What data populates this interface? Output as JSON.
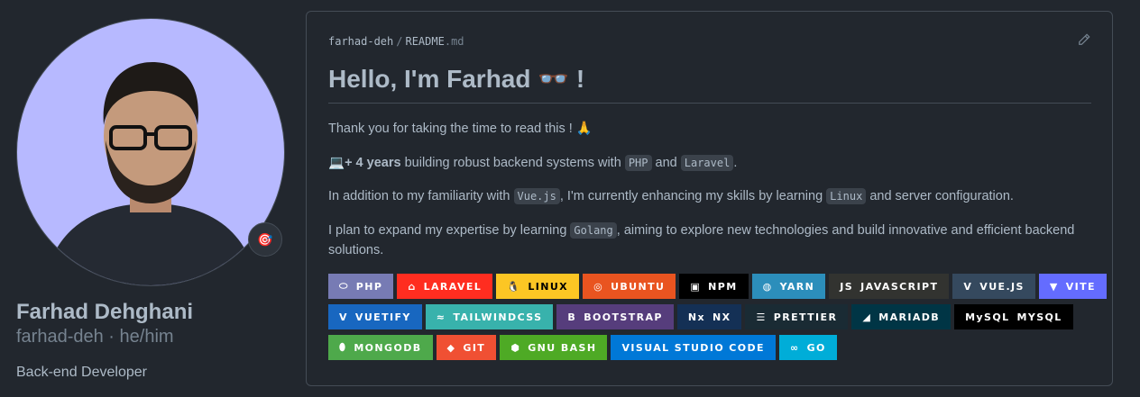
{
  "profile": {
    "name": "Farhad Dehghani",
    "handle": "farhad-deh · he/him",
    "bio": "Back-end Developer",
    "status_emoji": "🎯",
    "avatar_bg": "#b7b9ff"
  },
  "readme": {
    "user": "farhad-deh",
    "separator": "/",
    "file": "README",
    "ext": ".md",
    "title": "Hello, I'm Farhad 👓 !",
    "p1": "Thank you for taking the time to read this ! 🙏",
    "p2": {
      "emoji": "💻",
      "bold": "+ 4 years",
      "t1": " building robust backend systems with ",
      "c1": "PHP",
      "t2": " and ",
      "c2": "Laravel",
      "t3": "."
    },
    "p3": {
      "t1": "In addition to my familiarity with ",
      "c1": "Vue.js",
      "t2": ", I'm currently enhancing my skills by learning ",
      "c2": "Linux",
      "t3": " and server configuration."
    },
    "p4": {
      "t1": "I plan to expand my expertise by learning ",
      "c1": "Golang",
      "t2": ", aiming to explore new technologies and build innovative and efficient backend solutions."
    }
  },
  "badge_rows": [
    [
      {
        "label": "PHP",
        "icon": "⬭",
        "bg": "#777bb4"
      },
      {
        "label": "LARAVEL",
        "icon": "⌂",
        "bg": "#ff2d20"
      },
      {
        "label": "LINUX",
        "icon": "🐧",
        "bg": "#fcc624",
        "fg": "#000"
      },
      {
        "label": "UBUNTU",
        "icon": "◎",
        "bg": "#e95420"
      },
      {
        "label": "NPM",
        "icon": "▣",
        "bg": "#000000"
      },
      {
        "label": "YARN",
        "icon": "◍",
        "bg": "#2c8ebb"
      },
      {
        "label": "JAVASCRIPT",
        "icon": "JS",
        "bg": "#323330"
      },
      {
        "label": "VUE.JS",
        "icon": "V",
        "bg": "#35495e"
      },
      {
        "label": "VITE",
        "icon": "▼",
        "bg": "#646cff"
      }
    ],
    [
      {
        "label": "VUETIFY",
        "icon": "V",
        "bg": "#1867c0"
      },
      {
        "label": "TAILWINDCSS",
        "icon": "≈",
        "bg": "#38b2ac"
      },
      {
        "label": "BOOTSTRAP",
        "icon": "B",
        "bg": "#563d7c"
      },
      {
        "label": "NX",
        "icon": "Nx",
        "bg": "#143055"
      },
      {
        "label": "PRETTIER",
        "icon": "☰",
        "bg": "#1a2b34"
      },
      {
        "label": "MARIADB",
        "icon": "◢",
        "bg": "#003545"
      },
      {
        "label": "MYSQL",
        "icon": "MySQL",
        "bg": "#000000"
      }
    ],
    [
      {
        "label": "MONGODB",
        "icon": "⬮",
        "bg": "#4ea94b"
      },
      {
        "label": "GIT",
        "icon": "◆",
        "bg": "#f05033"
      },
      {
        "label": "GNU BASH",
        "icon": "⬢",
        "bg": "#4eaa25"
      },
      {
        "label": "VISUAL STUDIO CODE",
        "icon": "",
        "bg": "#0078d7"
      },
      {
        "label": "GO",
        "icon": "∞",
        "bg": "#00add8"
      }
    ]
  ]
}
